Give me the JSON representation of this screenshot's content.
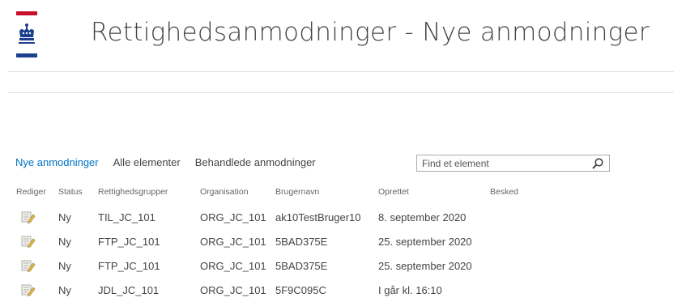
{
  "header": {
    "title": "Rettighedsanmodninger - Nye anmodninger",
    "logo_icon": "crown-icon",
    "logo_colors": {
      "top": "#c8102e",
      "bottom": "#1d3f8e"
    }
  },
  "views": {
    "items": [
      {
        "label": "Nye anmodninger",
        "active": true
      },
      {
        "label": "Alle elementer",
        "active": false
      },
      {
        "label": "Behandlede anmodninger",
        "active": false
      }
    ],
    "accent": "#0072c6"
  },
  "search": {
    "placeholder": "Find et element",
    "icon": "search-icon"
  },
  "table": {
    "columns": [
      "Rediger",
      "Status",
      "Rettighedsgrupper",
      "Organisation",
      "Brugernavn",
      "Oprettet",
      "Besked"
    ],
    "rows": [
      {
        "status": "Ny",
        "group": "TIL_JC_101",
        "org": "ORG_JC_101",
        "user": "ak10TestBruger10",
        "created": "8. september 2020",
        "message": ""
      },
      {
        "status": "Ny",
        "group": "FTP_JC_101",
        "org": "ORG_JC_101",
        "user": "5BAD375E",
        "created": "25. september 2020",
        "message": ""
      },
      {
        "status": "Ny",
        "group": "FTP_JC_101",
        "org": "ORG_JC_101",
        "user": "5BAD375E",
        "created": "25. september 2020",
        "message": ""
      },
      {
        "status": "Ny",
        "group": "JDL_JC_101",
        "org": "ORG_JC_101",
        "user": "5F9C095C",
        "created": "I går kl. 16:10",
        "message": ""
      }
    ],
    "edit_icon": "edit-icon"
  }
}
